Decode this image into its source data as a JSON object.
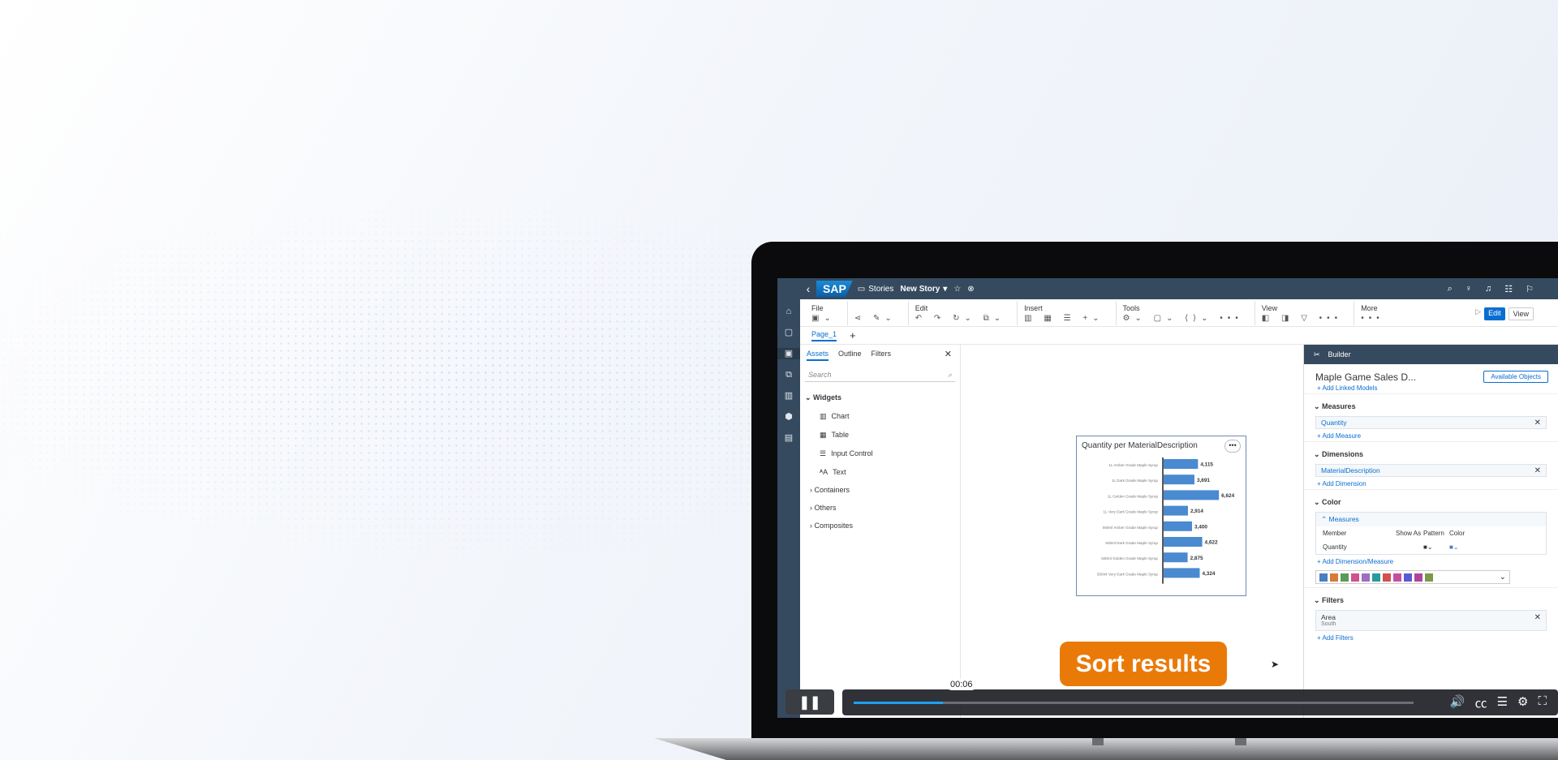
{
  "app": {
    "logo": "SAP",
    "nav_stories": "Stories",
    "story_title": "New Story",
    "story_title_suffix": "▾"
  },
  "toolbar": {
    "file": "File",
    "edit": "Edit",
    "insert": "Insert",
    "tools": "Tools",
    "view": "View",
    "more": "More",
    "edit_button": "Edit",
    "view_button": "View"
  },
  "page": {
    "tab": "Page_1",
    "add": "+"
  },
  "assets": {
    "tabs": [
      "Assets",
      "Outline",
      "Filters"
    ],
    "search_placeholder": "Search",
    "widgets_header": "Widgets",
    "widgets": [
      "Chart",
      "Table",
      "Input Control",
      "Text"
    ],
    "groups": [
      "Containers",
      "Others",
      "Composites"
    ]
  },
  "chart": {
    "title": "Quantity per MaterialDescription",
    "more": "•••"
  },
  "chart_data": {
    "type": "bar",
    "orientation": "horizontal",
    "title": "Quantity per MaterialDescription",
    "categories": [
      "1L Amber Grade Maple Syrup",
      "1L Dark Grade Maple Syrup",
      "1L Golden Grade Maple Syrup",
      "1L Very Dark Grade Maple Syrup",
      "500ml Amber Grade Maple Syrup",
      "500ml Dark Grade Maple Syrup",
      "500ml Golden Grade Maple Syrup",
      "500ml Very Dark Grade Maple Syrup"
    ],
    "values": [
      4115,
      3691,
      6624,
      2914,
      3400,
      4622,
      2875,
      4324
    ],
    "value_labels": [
      "4,115",
      "3,691",
      "6,624",
      "2,914",
      "3,400",
      "4,622",
      "2,875",
      "4,324"
    ],
    "bar_color": "#4a8ad0",
    "xlim": [
      0,
      7000
    ]
  },
  "builder": {
    "header": "Builder",
    "model_name": "Maple Game Sales D...",
    "available_objects": "Available Objects",
    "add_linked_models": "+ Add Linked Models",
    "measures_title": "Measures",
    "measure": "Quantity",
    "add_measure": "+ Add Measure",
    "dimensions_title": "Dimensions",
    "dimension": "MaterialDescription",
    "add_dimension": "+ Add Dimension",
    "color_title": "Color",
    "color_measures": "Measures",
    "col_member": "Member",
    "col_show_as": "Show As",
    "col_pattern": "Pattern",
    "col_color": "Color",
    "member_value": "Quantity",
    "add_dim_measure": "+ Add Dimension/Measure",
    "filters_title": "Filters",
    "filter_name": "Area",
    "filter_value": "South",
    "add_filters": "+ Add Filters",
    "palette": [
      "#4a7fc0",
      "#d77a3a",
      "#5a9a5a",
      "#d24f8e",
      "#9a6fc4",
      "#2a9a9a",
      "#d45050",
      "#c44fa0",
      "#5a5ad4",
      "#b0449a",
      "#7a9a4a"
    ]
  },
  "overlay": {
    "label": "Sort results"
  },
  "player": {
    "time": "00:06",
    "progress": 0.16
  },
  "colors": {
    "shell": "#354a5f",
    "accent": "#0a6ed1",
    "overlay": "#ea7a08"
  }
}
